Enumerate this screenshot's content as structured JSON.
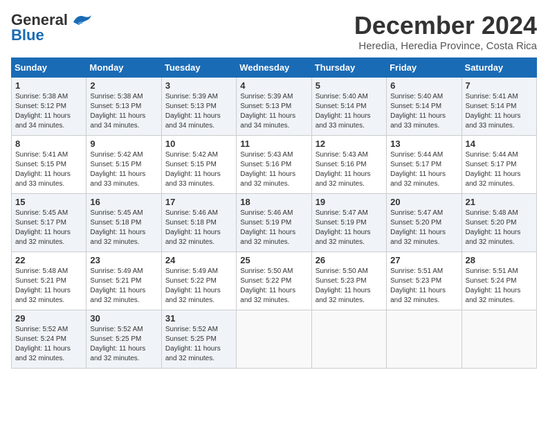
{
  "logo": {
    "line1": "General",
    "line2": "Blue"
  },
  "title": "December 2024",
  "location": "Heredia, Heredia Province, Costa Rica",
  "days_of_week": [
    "Sunday",
    "Monday",
    "Tuesday",
    "Wednesday",
    "Thursday",
    "Friday",
    "Saturday"
  ],
  "weeks": [
    [
      {
        "day": "1",
        "sunrise": "5:38 AM",
        "sunset": "5:12 PM",
        "daylight": "11 hours and 34 minutes."
      },
      {
        "day": "2",
        "sunrise": "5:38 AM",
        "sunset": "5:13 PM",
        "daylight": "11 hours and 34 minutes."
      },
      {
        "day": "3",
        "sunrise": "5:39 AM",
        "sunset": "5:13 PM",
        "daylight": "11 hours and 34 minutes."
      },
      {
        "day": "4",
        "sunrise": "5:39 AM",
        "sunset": "5:13 PM",
        "daylight": "11 hours and 34 minutes."
      },
      {
        "day": "5",
        "sunrise": "5:40 AM",
        "sunset": "5:14 PM",
        "daylight": "11 hours and 33 minutes."
      },
      {
        "day": "6",
        "sunrise": "5:40 AM",
        "sunset": "5:14 PM",
        "daylight": "11 hours and 33 minutes."
      },
      {
        "day": "7",
        "sunrise": "5:41 AM",
        "sunset": "5:14 PM",
        "daylight": "11 hours and 33 minutes."
      }
    ],
    [
      {
        "day": "8",
        "sunrise": "5:41 AM",
        "sunset": "5:15 PM",
        "daylight": "11 hours and 33 minutes."
      },
      {
        "day": "9",
        "sunrise": "5:42 AM",
        "sunset": "5:15 PM",
        "daylight": "11 hours and 33 minutes."
      },
      {
        "day": "10",
        "sunrise": "5:42 AM",
        "sunset": "5:15 PM",
        "daylight": "11 hours and 33 minutes."
      },
      {
        "day": "11",
        "sunrise": "5:43 AM",
        "sunset": "5:16 PM",
        "daylight": "11 hours and 32 minutes."
      },
      {
        "day": "12",
        "sunrise": "5:43 AM",
        "sunset": "5:16 PM",
        "daylight": "11 hours and 32 minutes."
      },
      {
        "day": "13",
        "sunrise": "5:44 AM",
        "sunset": "5:17 PM",
        "daylight": "11 hours and 32 minutes."
      },
      {
        "day": "14",
        "sunrise": "5:44 AM",
        "sunset": "5:17 PM",
        "daylight": "11 hours and 32 minutes."
      }
    ],
    [
      {
        "day": "15",
        "sunrise": "5:45 AM",
        "sunset": "5:17 PM",
        "daylight": "11 hours and 32 minutes."
      },
      {
        "day": "16",
        "sunrise": "5:45 AM",
        "sunset": "5:18 PM",
        "daylight": "11 hours and 32 minutes."
      },
      {
        "day": "17",
        "sunrise": "5:46 AM",
        "sunset": "5:18 PM",
        "daylight": "11 hours and 32 minutes."
      },
      {
        "day": "18",
        "sunrise": "5:46 AM",
        "sunset": "5:19 PM",
        "daylight": "11 hours and 32 minutes."
      },
      {
        "day": "19",
        "sunrise": "5:47 AM",
        "sunset": "5:19 PM",
        "daylight": "11 hours and 32 minutes."
      },
      {
        "day": "20",
        "sunrise": "5:47 AM",
        "sunset": "5:20 PM",
        "daylight": "11 hours and 32 minutes."
      },
      {
        "day": "21",
        "sunrise": "5:48 AM",
        "sunset": "5:20 PM",
        "daylight": "11 hours and 32 minutes."
      }
    ],
    [
      {
        "day": "22",
        "sunrise": "5:48 AM",
        "sunset": "5:21 PM",
        "daylight": "11 hours and 32 minutes."
      },
      {
        "day": "23",
        "sunrise": "5:49 AM",
        "sunset": "5:21 PM",
        "daylight": "11 hours and 32 minutes."
      },
      {
        "day": "24",
        "sunrise": "5:49 AM",
        "sunset": "5:22 PM",
        "daylight": "11 hours and 32 minutes."
      },
      {
        "day": "25",
        "sunrise": "5:50 AM",
        "sunset": "5:22 PM",
        "daylight": "11 hours and 32 minutes."
      },
      {
        "day": "26",
        "sunrise": "5:50 AM",
        "sunset": "5:23 PM",
        "daylight": "11 hours and 32 minutes."
      },
      {
        "day": "27",
        "sunrise": "5:51 AM",
        "sunset": "5:23 PM",
        "daylight": "11 hours and 32 minutes."
      },
      {
        "day": "28",
        "sunrise": "5:51 AM",
        "sunset": "5:24 PM",
        "daylight": "11 hours and 32 minutes."
      }
    ],
    [
      {
        "day": "29",
        "sunrise": "5:52 AM",
        "sunset": "5:24 PM",
        "daylight": "11 hours and 32 minutes."
      },
      {
        "day": "30",
        "sunrise": "5:52 AM",
        "sunset": "5:25 PM",
        "daylight": "11 hours and 32 minutes."
      },
      {
        "day": "31",
        "sunrise": "5:52 AM",
        "sunset": "5:25 PM",
        "daylight": "11 hours and 32 minutes."
      },
      null,
      null,
      null,
      null
    ]
  ]
}
